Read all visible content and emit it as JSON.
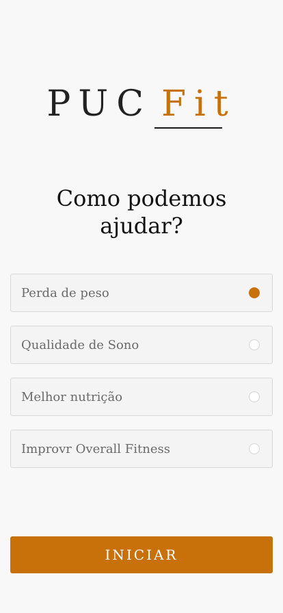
{
  "logo": {
    "part1": "PUC",
    "part2": "Fit"
  },
  "heading": {
    "line1": "Como podemos",
    "line2": "ajudar?"
  },
  "options": [
    {
      "label": "Perda de peso",
      "selected": true
    },
    {
      "label": "Qualidade de Sono",
      "selected": false
    },
    {
      "label": "Melhor nutrição",
      "selected": false
    },
    {
      "label": "Improvr Overall Fitness",
      "selected": false
    }
  ],
  "start_button": {
    "label": "INICIAR"
  },
  "colors": {
    "accent": "#c8700a",
    "background": "#f8f8f8",
    "option_background": "#f4f4f4"
  }
}
